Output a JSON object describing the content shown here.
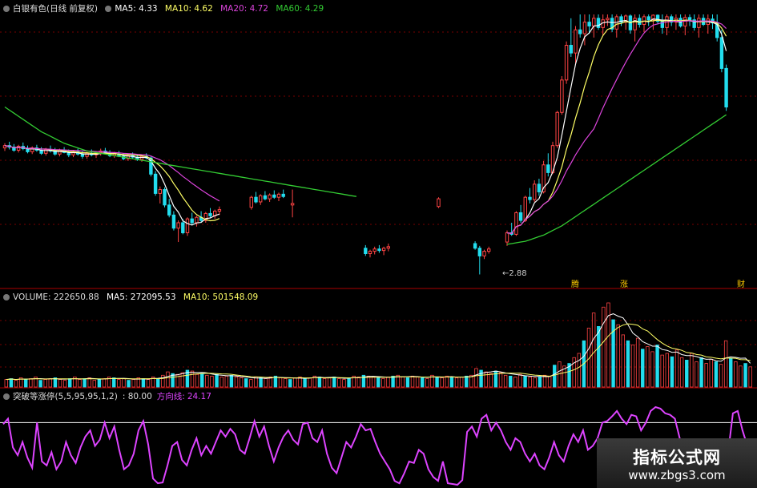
{
  "header_main": {
    "title": "白银有色(日线 前复权)",
    "ma5": "MA5: 4.33",
    "ma10": "MA10: 4.62",
    "ma20": "MA20: 4.72",
    "ma60": "MA60: 4.29"
  },
  "header_volume": {
    "volume": "VOLUME: 222650.88",
    "ma5": "MA5: 272095.53",
    "ma10": "MA10: 501548.09"
  },
  "header_indicator": {
    "name": "突破等涨停(5,5,95,95,1,2)",
    "level": ": 80.00",
    "line_label": "方向线:",
    "line_value": "24.17"
  },
  "annotations": {
    "low_price": "2.88",
    "tag1": "腾",
    "tag2": "涨",
    "tag3": "财"
  },
  "watermark": {
    "title": "指标公式网",
    "url": "www.zbgs3.com"
  },
  "colors": {
    "up": "#ff4444",
    "down": "#22ddee",
    "ma5": "#ffffff",
    "ma10": "#ffff66",
    "ma20": "#dd44dd",
    "ma60": "#33cc33",
    "indicator": "#dd44ff",
    "grid": "#7a0000"
  },
  "chart_data": {
    "type": "candlestick",
    "price_series": [
      [
        4.52,
        4.58,
        4.48,
        4.55
      ],
      [
        4.55,
        4.6,
        4.5,
        4.53
      ],
      [
        4.53,
        4.57,
        4.47,
        4.49
      ],
      [
        4.49,
        4.56,
        4.46,
        4.54
      ],
      [
        4.54,
        4.59,
        4.49,
        4.51
      ],
      [
        4.51,
        4.55,
        4.45,
        4.47
      ],
      [
        4.47,
        4.54,
        4.44,
        4.52
      ],
      [
        4.52,
        4.56,
        4.47,
        4.49
      ],
      [
        4.49,
        4.53,
        4.43,
        4.45
      ],
      [
        4.45,
        4.52,
        4.42,
        4.5
      ],
      [
        4.5,
        4.55,
        4.46,
        4.48
      ],
      [
        4.48,
        4.52,
        4.42,
        4.44
      ],
      [
        4.44,
        4.51,
        4.41,
        4.49
      ],
      [
        4.49,
        4.53,
        4.45,
        4.46
      ],
      [
        4.46,
        4.5,
        4.4,
        4.43
      ],
      [
        4.43,
        4.49,
        4.4,
        4.47
      ],
      [
        4.47,
        4.51,
        4.42,
        4.44
      ],
      [
        4.44,
        4.48,
        4.38,
        4.41
      ],
      [
        4.41,
        4.47,
        4.38,
        4.45
      ],
      [
        4.45,
        4.5,
        4.41,
        4.43
      ],
      [
        4.43,
        4.48,
        4.39,
        4.46
      ],
      [
        4.46,
        4.51,
        4.42,
        4.48
      ],
      [
        4.48,
        4.52,
        4.44,
        4.45
      ],
      [
        4.45,
        4.49,
        4.4,
        4.42
      ],
      [
        4.42,
        4.47,
        4.39,
        4.44
      ],
      [
        4.44,
        4.48,
        4.4,
        4.41
      ],
      [
        4.41,
        4.45,
        4.36,
        4.38
      ],
      [
        4.38,
        4.44,
        4.35,
        4.42
      ],
      [
        4.42,
        4.46,
        4.38,
        4.4
      ],
      [
        4.4,
        4.44,
        4.35,
        4.37
      ],
      [
        4.37,
        4.43,
        4.34,
        4.41
      ],
      [
        4.41,
        4.45,
        4.37,
        4.39
      ],
      [
        4.39,
        4.41,
        4.15,
        4.18
      ],
      [
        4.18,
        4.22,
        3.9,
        3.93
      ],
      [
        3.93,
        4.02,
        3.8,
        3.98
      ],
      [
        3.98,
        4.01,
        3.75,
        3.78
      ],
      [
        3.78,
        3.86,
        3.62,
        3.65
      ],
      [
        3.65,
        3.7,
        3.45,
        3.48
      ],
      [
        3.48,
        3.58,
        3.3,
        3.55
      ],
      [
        3.55,
        3.6,
        3.4,
        3.42
      ],
      [
        3.42,
        3.62,
        3.38,
        3.6
      ],
      [
        3.6,
        3.68,
        3.52,
        3.55
      ],
      [
        3.55,
        3.64,
        3.5,
        3.62
      ],
      [
        3.62,
        3.7,
        3.56,
        3.58
      ],
      [
        3.58,
        3.69,
        3.55,
        3.67
      ],
      [
        3.67,
        3.74,
        3.62,
        3.64
      ],
      [
        3.64,
        3.72,
        3.6,
        3.7
      ],
      [
        3.7,
        3.76,
        3.65,
        3.72
      ]
    ],
    "price_gap_start": 48,
    "price_series_2": [
      [
        3.75,
        3.9,
        3.72,
        3.88
      ],
      [
        3.88,
        3.95,
        3.8,
        3.82
      ],
      [
        3.82,
        3.92,
        3.78,
        3.9
      ],
      [
        3.9,
        3.96,
        3.84,
        3.86
      ],
      [
        3.86,
        3.93,
        3.82,
        3.91
      ],
      [
        3.91,
        3.97,
        3.86,
        3.88
      ],
      [
        3.88,
        3.94,
        3.83,
        3.92
      ],
      [
        3.92,
        3.98,
        3.87,
        3.89
      ]
    ],
    "isolated_points": [
      {
        "i": 63,
        "o": 3.78,
        "h": 3.98,
        "l": 3.62,
        "c": 3.8
      },
      {
        "i": 79,
        "o": 3.22,
        "h": 3.26,
        "l": 3.12,
        "c": 3.15
      },
      {
        "i": 80,
        "o": 3.15,
        "h": 3.2,
        "l": 3.1,
        "c": 3.18
      },
      {
        "i": 81,
        "o": 3.18,
        "h": 3.24,
        "l": 3.14,
        "c": 3.21
      },
      {
        "i": 82,
        "o": 3.21,
        "h": 3.26,
        "l": 3.16,
        "c": 3.19
      },
      {
        "i": 83,
        "o": 3.19,
        "h": 3.24,
        "l": 3.13,
        "c": 3.22
      },
      {
        "i": 84,
        "o": 3.22,
        "h": 3.28,
        "l": 3.18,
        "c": 3.24
      },
      {
        "i": 95,
        "o": 3.76,
        "h": 3.88,
        "l": 3.74,
        "c": 3.86
      },
      {
        "i": 103,
        "o": 3.28,
        "h": 3.31,
        "l": 3.2,
        "c": 3.22
      },
      {
        "i": 104,
        "o": 3.22,
        "h": 3.25,
        "l": 2.88,
        "c": 3.12
      },
      {
        "i": 105,
        "o": 3.12,
        "h": 3.2,
        "l": 3.08,
        "c": 3.18
      },
      {
        "i": 106,
        "o": 3.18,
        "h": 3.24,
        "l": 3.15,
        "c": 3.21
      }
    ],
    "rally_series_start": 110,
    "rally_series": [
      [
        3.3,
        3.45,
        3.25,
        3.42
      ],
      [
        3.42,
        3.55,
        3.38,
        3.4
      ],
      [
        3.4,
        3.7,
        3.38,
        3.68
      ],
      [
        3.68,
        3.78,
        3.55,
        3.58
      ],
      [
        3.58,
        3.9,
        3.56,
        3.88
      ],
      [
        3.88,
        4.0,
        3.8,
        3.85
      ],
      [
        3.85,
        4.1,
        3.82,
        4.05
      ],
      [
        4.05,
        4.12,
        3.9,
        3.95
      ],
      [
        3.95,
        4.35,
        3.93,
        4.3
      ],
      [
        4.3,
        4.45,
        4.15,
        4.2
      ],
      [
        4.2,
        4.6,
        4.18,
        4.55
      ],
      [
        4.55,
        5.0,
        4.52,
        4.98
      ],
      [
        4.98,
        5.45,
        4.95,
        5.4
      ],
      [
        5.4,
        5.9,
        5.35,
        5.85
      ],
      [
        5.85,
        6.2,
        5.7,
        5.75
      ],
      [
        5.75,
        6.1,
        5.6,
        6.05
      ],
      [
        6.05,
        6.25,
        5.95,
        6.0
      ],
      [
        6.0,
        6.25,
        5.85,
        6.15
      ],
      [
        6.15,
        6.25,
        6.0,
        6.1
      ],
      [
        6.1,
        6.25,
        5.95,
        6.2
      ],
      [
        6.2,
        6.25,
        6.05,
        6.08
      ],
      [
        6.08,
        6.25,
        5.98,
        6.18
      ],
      [
        6.18,
        6.25,
        6.1,
        6.2
      ],
      [
        6.2,
        6.25,
        6.02,
        6.06
      ],
      [
        6.06,
        6.25,
        5.95,
        6.22
      ],
      [
        6.22,
        6.25,
        6.1,
        6.15
      ],
      [
        6.15,
        6.25,
        6.05,
        6.23
      ],
      [
        6.23,
        6.25,
        6.0,
        6.05
      ],
      [
        6.05,
        6.25,
        5.9,
        6.2
      ],
      [
        6.2,
        6.25,
        6.08,
        6.12
      ],
      [
        6.12,
        6.25,
        6.02,
        6.22
      ],
      [
        6.22,
        6.25,
        6.1,
        6.18
      ],
      [
        6.18,
        6.25,
        6.05,
        6.24
      ],
      [
        6.24,
        6.25,
        6.12,
        6.16
      ],
      [
        6.16,
        6.25,
        6.0,
        6.08
      ],
      [
        6.08,
        6.25,
        5.98,
        6.22
      ],
      [
        6.22,
        6.25,
        6.1,
        6.15
      ],
      [
        6.15,
        6.25,
        6.05,
        6.2
      ],
      [
        6.2,
        6.25,
        6.08,
        6.1
      ],
      [
        6.1,
        6.25,
        5.98,
        6.21
      ],
      [
        6.21,
        6.25,
        6.1,
        6.18
      ],
      [
        6.18,
        6.25,
        6.04,
        6.08
      ],
      [
        6.08,
        6.25,
        5.95,
        6.2
      ],
      [
        6.2,
        6.25,
        6.1,
        6.12
      ],
      [
        6.12,
        6.25,
        6.0,
        6.19
      ],
      [
        6.19,
        6.25,
        6.06,
        6.14
      ],
      [
        6.14,
        6.25,
        5.9,
        5.95
      ],
      [
        5.95,
        6.05,
        5.5,
        5.55
      ],
      [
        5.55,
        5.6,
        5.0,
        5.05
      ]
    ],
    "ma60_series": [
      5.05,
      5.01,
      4.97,
      4.93,
      4.89,
      4.85,
      4.81,
      4.77,
      4.73,
      4.7,
      4.67,
      4.64,
      4.61,
      4.58,
      4.56,
      4.54,
      4.52,
      4.5,
      4.48,
      4.47,
      4.46,
      4.45,
      4.44,
      4.43,
      4.42,
      4.41,
      4.4,
      4.39,
      4.38,
      4.37,
      4.36,
      4.35,
      4.34,
      4.33,
      4.32,
      4.31,
      4.3,
      4.29,
      4.28,
      4.27,
      4.26,
      4.25,
      4.24,
      4.23,
      4.22,
      4.21,
      4.2,
      4.19,
      4.18,
      4.17,
      4.16,
      4.15,
      4.14,
      4.13,
      4.12,
      4.11,
      4.1,
      4.09,
      4.08,
      4.07,
      4.06,
      4.05,
      4.04,
      4.03,
      4.02,
      4.01,
      4.0,
      3.99,
      3.98,
      3.97,
      3.96,
      3.95,
      3.94,
      3.93,
      3.92,
      3.91,
      3.9,
      3.89
    ],
    "ma60_rally": [
      3.27,
      3.28,
      3.29,
      3.3,
      3.31,
      3.33,
      3.35,
      3.37,
      3.39,
      3.42,
      3.45,
      3.48,
      3.51,
      3.55,
      3.59,
      3.63,
      3.67,
      3.71,
      3.75,
      3.79,
      3.83,
      3.87,
      3.91,
      3.95,
      3.99,
      4.03,
      4.07,
      4.11,
      4.15,
      4.19,
      4.23,
      4.27,
      4.31,
      4.35,
      4.39,
      4.43,
      4.47,
      4.51,
      4.55,
      4.59,
      4.63,
      4.67,
      4.71,
      4.75,
      4.79,
      4.83,
      4.87,
      4.91,
      4.95
    ],
    "volume": [
      0.09,
      0.1,
      0.08,
      0.11,
      0.09,
      0.1,
      0.12,
      0.08,
      0.09,
      0.1,
      0.11,
      0.09,
      0.08,
      0.1,
      0.12,
      0.09,
      0.1,
      0.11,
      0.08,
      0.09,
      0.1,
      0.12,
      0.11,
      0.09,
      0.1,
      0.08,
      0.09,
      0.11,
      0.1,
      0.09,
      0.12,
      0.1,
      0.14,
      0.18,
      0.16,
      0.15,
      0.17,
      0.2,
      0.19,
      0.15,
      0.16,
      0.14,
      0.13,
      0.15,
      0.12,
      0.13,
      0.14,
      0.12,
      0.11,
      0.1,
      0.09,
      0.12,
      0.11,
      0.1,
      0.12,
      0.13,
      0.11,
      0.1,
      0.09,
      0.11,
      0.12,
      0.1,
      0.11,
      0.13,
      0.12,
      0.1,
      0.11,
      0.12,
      0.1,
      0.09,
      0.11,
      0.13,
      0.12,
      0.14,
      0.13,
      0.12,
      0.11,
      0.1,
      0.12,
      0.13,
      0.14,
      0.12,
      0.11,
      0.13,
      0.12,
      0.11,
      0.1,
      0.14,
      0.12,
      0.11,
      0.13,
      0.12,
      0.11,
      0.12,
      0.13,
      0.14,
      0.22,
      0.2,
      0.18,
      0.16,
      0.19,
      0.17,
      0.14,
      0.13,
      0.12,
      0.15,
      0.13,
      0.12,
      0.11,
      0.12,
      0.14,
      0.13,
      0.26,
      0.3,
      0.25,
      0.28,
      0.35,
      0.4,
      0.55,
      0.7,
      0.88,
      0.72,
      0.95,
      1.0,
      0.8,
      0.74,
      0.62,
      0.55,
      0.5,
      0.58,
      0.45,
      0.48,
      0.42,
      0.5,
      0.38,
      0.4,
      0.36,
      0.44,
      0.35,
      0.32,
      0.4,
      0.3,
      0.35,
      0.28,
      0.33,
      0.3,
      0.27,
      0.55,
      0.34,
      0.3,
      0.25,
      0.28,
      0.24
    ],
    "indicator": [
      0.78,
      0.85,
      0.48,
      0.38,
      0.55,
      0.35,
      0.22,
      0.8,
      0.3,
      0.25,
      0.42,
      0.2,
      0.3,
      0.55,
      0.38,
      0.28,
      0.48,
      0.62,
      0.7,
      0.5,
      0.58,
      0.8,
      0.6,
      0.75,
      0.45,
      0.2,
      0.25,
      0.4,
      0.7,
      0.82,
      0.52,
      0.08,
      0.02,
      0.03,
      0.25,
      0.5,
      0.55,
      0.32,
      0.25,
      0.45,
      0.6,
      0.38,
      0.5,
      0.4,
      0.55,
      0.7,
      0.62,
      0.72,
      0.65,
      0.45,
      0.4,
      0.6,
      0.82,
      0.62,
      0.75,
      0.5,
      0.3,
      0.48,
      0.62,
      0.7,
      0.58,
      0.52,
      0.78,
      0.8,
      0.6,
      0.55,
      0.7,
      0.4,
      0.22,
      0.15,
      0.35,
      0.55,
      0.48,
      0.62,
      0.78,
      0.7,
      0.72,
      0.55,
      0.4,
      0.3,
      0.2,
      0.05,
      0.02,
      0.15,
      0.3,
      0.28,
      0.45,
      0.4,
      0.2,
      0.1,
      0.05,
      0.3,
      0.02,
      0.01,
      0.0,
      0.06,
      0.68,
      0.75,
      0.62,
      0.85,
      0.9,
      0.7,
      0.8,
      0.7,
      0.55,
      0.45,
      0.6,
      0.55,
      0.4,
      0.3,
      0.4,
      0.25,
      0.2,
      0.35,
      0.55,
      0.38,
      0.3,
      0.5,
      0.65,
      0.55,
      0.7,
      0.45,
      0.5,
      0.6,
      0.8,
      0.82,
      0.88,
      0.95,
      0.85,
      0.78,
      0.9,
      0.88,
      0.7,
      0.8,
      0.95,
      1.0,
      0.98,
      0.92,
      0.9,
      0.85,
      0.6,
      0.35,
      0.5,
      0.4,
      0.35,
      0.52,
      0.45,
      0.38,
      0.55,
      0.48,
      0.4,
      0.92,
      0.95,
      0.7,
      0.5,
      0.45
    ],
    "indicator_level": 80,
    "y_price_range": [
      2.75,
      6.25
    ]
  }
}
